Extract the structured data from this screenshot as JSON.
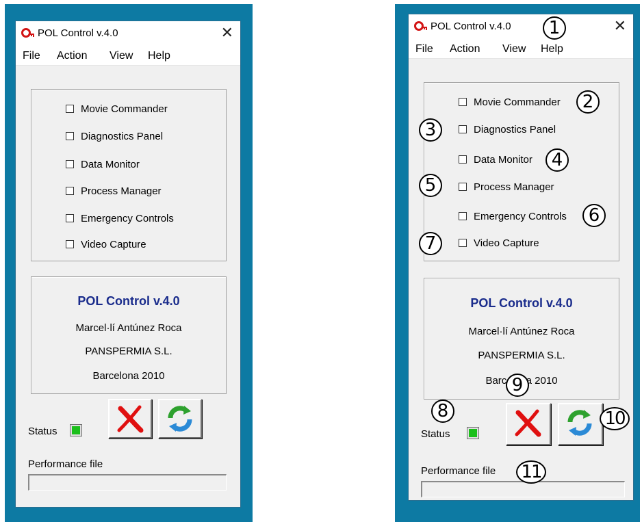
{
  "window": {
    "title": "POL Control v.4.0",
    "close_glyph": "✕"
  },
  "menu": [
    "File",
    "Action",
    "View",
    "Help"
  ],
  "checkboxes": [
    {
      "label": "Movie Commander",
      "checked": false
    },
    {
      "label": "Diagnostics Panel",
      "checked": false
    },
    {
      "label": "Data Monitor",
      "checked": false
    },
    {
      "label": "Process Manager",
      "checked": false
    },
    {
      "label": "Emergency Controls",
      "checked": false
    },
    {
      "label": "Video Capture",
      "checked": false
    }
  ],
  "about": {
    "title": "POL Control v.4.0",
    "author": "Marcel·lí Antúnez Roca",
    "company": "PANSPERMIA S.L.",
    "place": "Barcelona 2010"
  },
  "status": {
    "label": "Status",
    "color": "#1bbf1b"
  },
  "buttons": {
    "stop_icon": "red-x-icon",
    "refresh_icon": "refresh-arrows-icon"
  },
  "performance": {
    "label": "Performance file",
    "value": ""
  },
  "callouts": [
    "1",
    "2",
    "3",
    "4",
    "5",
    "6",
    "7",
    "8",
    "9",
    "10",
    "11"
  ],
  "colors": {
    "background": "#0d7aa3",
    "about_title": "#1a2c8c"
  }
}
